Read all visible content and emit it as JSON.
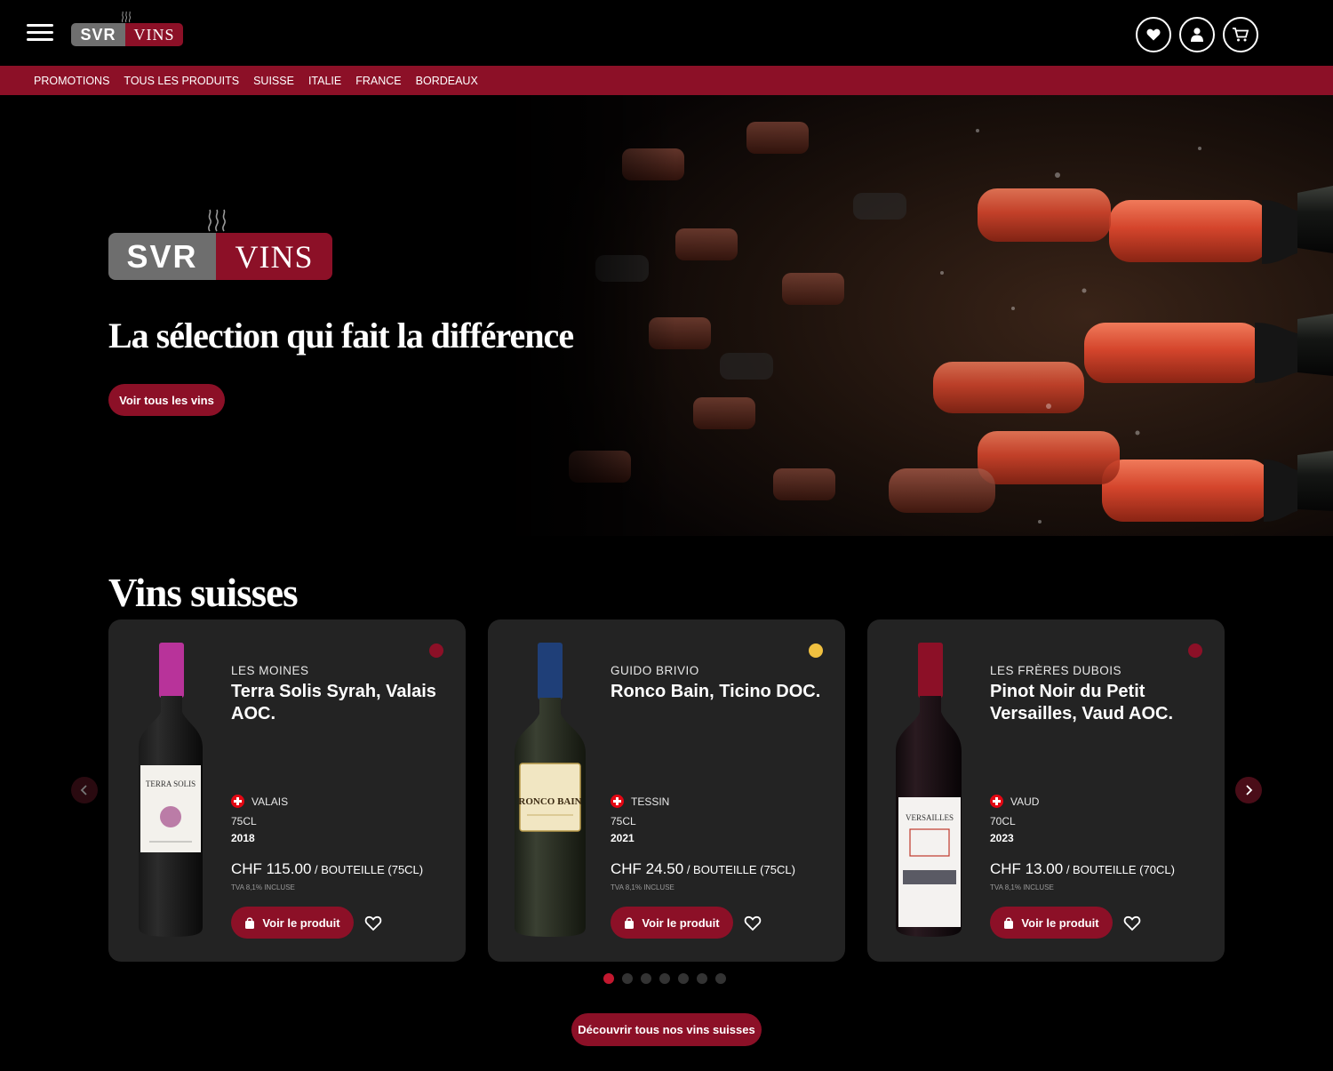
{
  "header": {
    "menu_icon": "hamburger-menu-icon",
    "logo": {
      "left": "SVR",
      "right": "VINS"
    },
    "icons": [
      "heart-icon",
      "user-icon",
      "cart-icon"
    ]
  },
  "nav": {
    "items": [
      "PROMOTIONS",
      "TOUS LES PRODUITS",
      "SUISSE",
      "ITALIE",
      "FRANCE",
      "BORDEAUX"
    ]
  },
  "hero": {
    "logo": {
      "left": "SVR",
      "right": "VINS"
    },
    "title": "La sélection qui fait la différence",
    "button": "Voir tous les vins"
  },
  "section": {
    "title": "Vins suisses",
    "cards": [
      {
        "producer": "LES MOINES",
        "name": "Terra Solis Syrah, Valais AOC.",
        "region": "VALAIS",
        "volume": "75CL",
        "year": "2018",
        "price": "CHF 115.00",
        "unit": " / BOUTEILLE (75CL)",
        "tva": "TVA 8,1% INCLUSE",
        "button": "Voir le produit",
        "type_color": "#8c1027",
        "label_text": "TERRA SOLIS"
      },
      {
        "producer": "GUIDO BRIVIO",
        "name": "Ronco Bain, Ticino DOC.",
        "region": "TESSIN",
        "volume": "75CL",
        "year": "2021",
        "price": "CHF 24.50",
        "unit": " / BOUTEILLE (75CL)",
        "tva": "TVA 8,1% INCLUSE",
        "button": "Voir le produit",
        "type_color": "#f0c040",
        "label_text": "RONCO BAIN"
      },
      {
        "producer": "LES FRÈRES DUBOIS",
        "name": "Pinot Noir du Petit Versailles, Vaud AOC.",
        "region": "VAUD",
        "volume": "70CL",
        "year": "2023",
        "price": "CHF 13.00",
        "unit": " / BOUTEILLE (70CL)",
        "tva": "TVA 8,1% INCLUSE",
        "button": "Voir le produit",
        "type_color": "#8c1027",
        "label_text": "VERSAILLES"
      }
    ],
    "pager": {
      "count": 7,
      "active": 1
    },
    "discover_button": "Découvrir tous nos vins suisses"
  },
  "colors": {
    "brand_red": "#8c1027",
    "brand_grey": "#6f6f6f",
    "card_bg": "#232323"
  }
}
